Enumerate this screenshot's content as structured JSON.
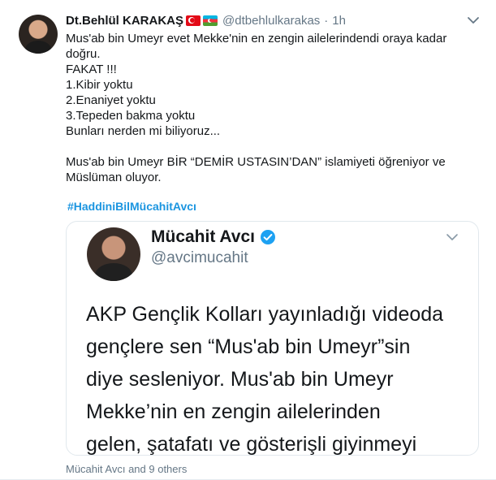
{
  "tweet": {
    "display_name": "Dt.Behlül KARAKAŞ",
    "flags": [
      "turkey-flag-icon",
      "azerbaijan-flag-icon"
    ],
    "handle": "@dtbehlulkarakas",
    "separator": "·",
    "time": "1h",
    "lines": [
      "Mus'ab bin Umeyr evet Mekke'nin en zengin ailelerindendi oraya kadar",
      "doğru.",
      "FAKAT !!!",
      "1.Kibir yoktu",
      "2.Enaniyet yoktu",
      "3.Tepeden bakma yoktu",
      "Bunları nerden mi biliyoruz...",
      "",
      "Mus'ab bin Umeyr BİR  “DEMİR USTASIN’DAN” islamiyeti öğreniyor ve",
      "Müslüman oluyor."
    ],
    "hashtag": "#HaddiniBilMücahitAvcı"
  },
  "quoted": {
    "display_name": "Mücahit Avcı",
    "handle": "@avcimucahit",
    "lines": [
      "AKP Gençlik Kolları yayınladığı videoda",
      "gençlere sen “Mus'ab bin Umeyr”sin",
      "diye sesleniyor. Mus'ab bin Umeyr",
      "Mekke’nin en zengin ailelerinden",
      "gelen, şatafatı ve gösterişli giyinmeyi"
    ]
  },
  "footer": {
    "liked_by": "Mücahit Avcı and 9 others"
  },
  "colors": {
    "link": "#1b95e0",
    "muted": "#657786",
    "text": "#14171a",
    "verified": "#1da1f2"
  }
}
